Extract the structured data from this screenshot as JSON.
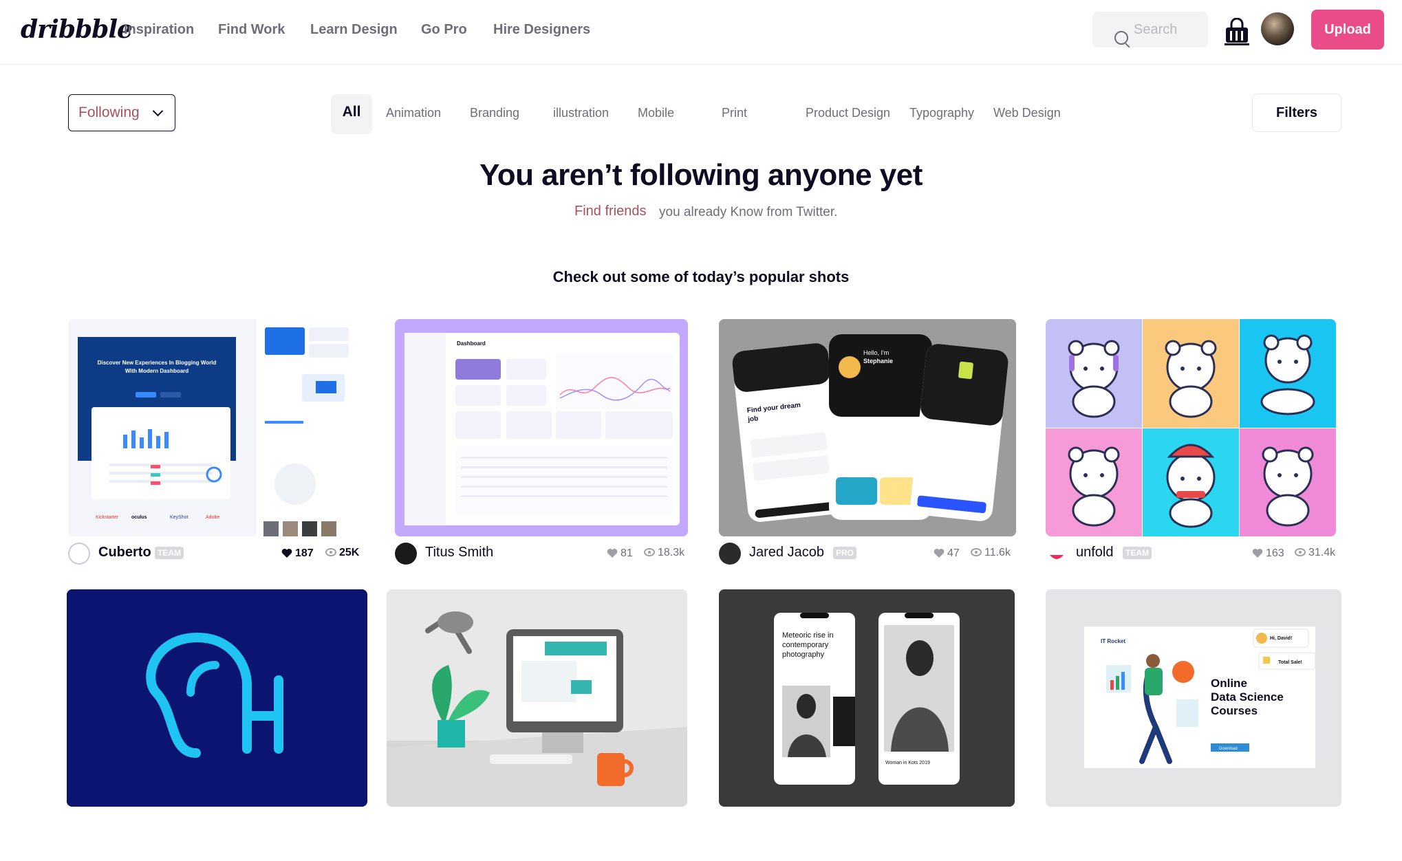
{
  "header": {
    "logo": "dribbble",
    "nav": [
      "Inspiration",
      "Find Work",
      "Learn Design",
      "Go Pro",
      "Hire Designers"
    ],
    "search_placeholder": "Search",
    "upload_label": "Upload"
  },
  "filter_bar": {
    "following_label": "Following",
    "categories": [
      "All",
      "Animation",
      "Branding",
      "illustration",
      "Mobile",
      "Print",
      "Product Design",
      "Typography",
      "Web Design"
    ],
    "active_category": "All",
    "filters_label": "Filters"
  },
  "empty_state": {
    "title": "You aren’t following anyone yet",
    "find_friends": "Find friends",
    "subtitle": "you already Know from Twitter."
  },
  "popular_heading": "Check out some of today’s popular shots",
  "shots": [
    {
      "author": "Cuberto",
      "badge": "TEAM",
      "likes": "187",
      "views": "25K",
      "title": "Discover New Experiences In Blogging World With Modern Dashboard",
      "emphasized_stats": true
    },
    {
      "author": "Titus Smith",
      "badge": "",
      "likes": "81",
      "views": "18.3k",
      "title": "Dashboard",
      "emphasized_stats": false
    },
    {
      "author": "Jared Jacob",
      "badge": "PRO",
      "likes": "47",
      "views": "11.6k",
      "title": "Find your dream job",
      "emphasized_stats": false
    },
    {
      "author": "unfold",
      "badge": "TEAM",
      "likes": "163",
      "views": "31.4k",
      "title": "",
      "emphasized_stats": false
    }
  ],
  "shots_row2": [
    {
      "title": ""
    },
    {
      "title": ""
    },
    {
      "title": "Meteoric rise in contemporary photography",
      "caption": "Woman in Kots 2019"
    },
    {
      "title": "Online Data Science Courses",
      "brand": "IT Rocket",
      "greeting": "Hi, David!",
      "sale": "Total Sale!",
      "button": "Download"
    }
  ],
  "colors": {
    "accent": "#ea4c89",
    "text": "#0d0c22",
    "muted": "#6e6d7a"
  }
}
